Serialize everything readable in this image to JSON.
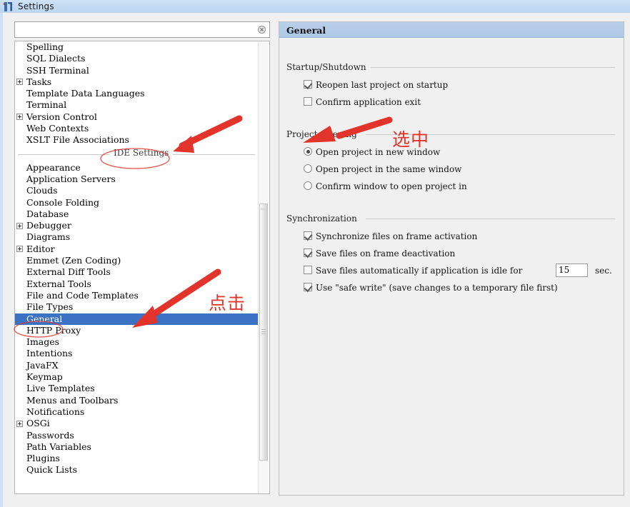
{
  "window": {
    "title": "Settings",
    "icon": "intellij-logo-icon"
  },
  "search": {
    "value": "",
    "placeholder": "",
    "clear_icon": "clear-circle-icon"
  },
  "tree": {
    "top_items": [
      {
        "label": "Spelling",
        "expandable": false
      },
      {
        "label": "SQL Dialects",
        "expandable": false
      },
      {
        "label": "SSH Terminal",
        "expandable": false
      },
      {
        "label": "Tasks",
        "expandable": true
      },
      {
        "label": "Template Data Languages",
        "expandable": false
      },
      {
        "label": "Terminal",
        "expandable": false
      },
      {
        "label": "Version Control",
        "expandable": true
      },
      {
        "label": "Web Contexts",
        "expandable": false
      },
      {
        "label": "XSLT File Associations",
        "expandable": false
      }
    ],
    "separator_label": "IDE Settings",
    "bottom_items": [
      {
        "label": "Appearance",
        "expandable": false,
        "selected": false
      },
      {
        "label": "Application Servers",
        "expandable": false,
        "selected": false
      },
      {
        "label": "Clouds",
        "expandable": false,
        "selected": false
      },
      {
        "label": "Console Folding",
        "expandable": false,
        "selected": false
      },
      {
        "label": "Database",
        "expandable": false,
        "selected": false
      },
      {
        "label": "Debugger",
        "expandable": true,
        "selected": false
      },
      {
        "label": "Diagrams",
        "expandable": false,
        "selected": false
      },
      {
        "label": "Editor",
        "expandable": true,
        "selected": false
      },
      {
        "label": "Emmet (Zen Coding)",
        "expandable": false,
        "selected": false
      },
      {
        "label": "External Diff Tools",
        "expandable": false,
        "selected": false
      },
      {
        "label": "External Tools",
        "expandable": false,
        "selected": false
      },
      {
        "label": "File and Code Templates",
        "expandable": false,
        "selected": false
      },
      {
        "label": "File Types",
        "expandable": false,
        "selected": false
      },
      {
        "label": "General",
        "expandable": false,
        "selected": true
      },
      {
        "label": "HTTP Proxy",
        "expandable": false,
        "selected": false
      },
      {
        "label": "Images",
        "expandable": false,
        "selected": false
      },
      {
        "label": "Intentions",
        "expandable": false,
        "selected": false
      },
      {
        "label": "JavaFX",
        "expandable": false,
        "selected": false
      },
      {
        "label": "Keymap",
        "expandable": false,
        "selected": false
      },
      {
        "label": "Live Templates",
        "expandable": false,
        "selected": false
      },
      {
        "label": "Menus and Toolbars",
        "expandable": false,
        "selected": false
      },
      {
        "label": "Notifications",
        "expandable": false,
        "selected": false
      },
      {
        "label": "OSGi",
        "expandable": true,
        "selected": false
      },
      {
        "label": "Passwords",
        "expandable": false,
        "selected": false
      },
      {
        "label": "Path Variables",
        "expandable": false,
        "selected": false
      },
      {
        "label": "Plugins",
        "expandable": false,
        "selected": false
      },
      {
        "label": "Quick Lists",
        "expandable": false,
        "selected": false
      }
    ]
  },
  "panel": {
    "title": "General",
    "groups": [
      {
        "name": "Startup/Shutdown",
        "options": [
          {
            "type": "checkbox",
            "label": "Reopen last project on startup",
            "checked": true
          },
          {
            "type": "checkbox",
            "label": "Confirm application exit",
            "checked": false
          }
        ]
      },
      {
        "name": "Project Opening",
        "options": [
          {
            "type": "radio",
            "label": "Open project in new window",
            "checked": true
          },
          {
            "type": "radio",
            "label": "Open project in the same window",
            "checked": false
          },
          {
            "type": "radio",
            "label": "Confirm window to open project in",
            "checked": false
          }
        ]
      },
      {
        "name": "Synchronization",
        "options": [
          {
            "type": "checkbox",
            "label": "Synchronize files on frame activation",
            "checked": true
          },
          {
            "type": "checkbox",
            "label": "Save files on frame deactivation",
            "checked": true
          },
          {
            "type": "checkbox",
            "label": "Save files automatically if application is idle for",
            "checked": false,
            "field_value": "15",
            "field_suffix": "sec."
          },
          {
            "type": "checkbox",
            "label": "Use \"safe write\" (save changes to a temporary file first)",
            "checked": true
          }
        ]
      }
    ]
  },
  "annotations": {
    "select_label": "选中",
    "click_label": "点击",
    "color": "#e2342a",
    "ellipse_ide_settings": "IDE Settings",
    "ellipse_general": "General"
  }
}
